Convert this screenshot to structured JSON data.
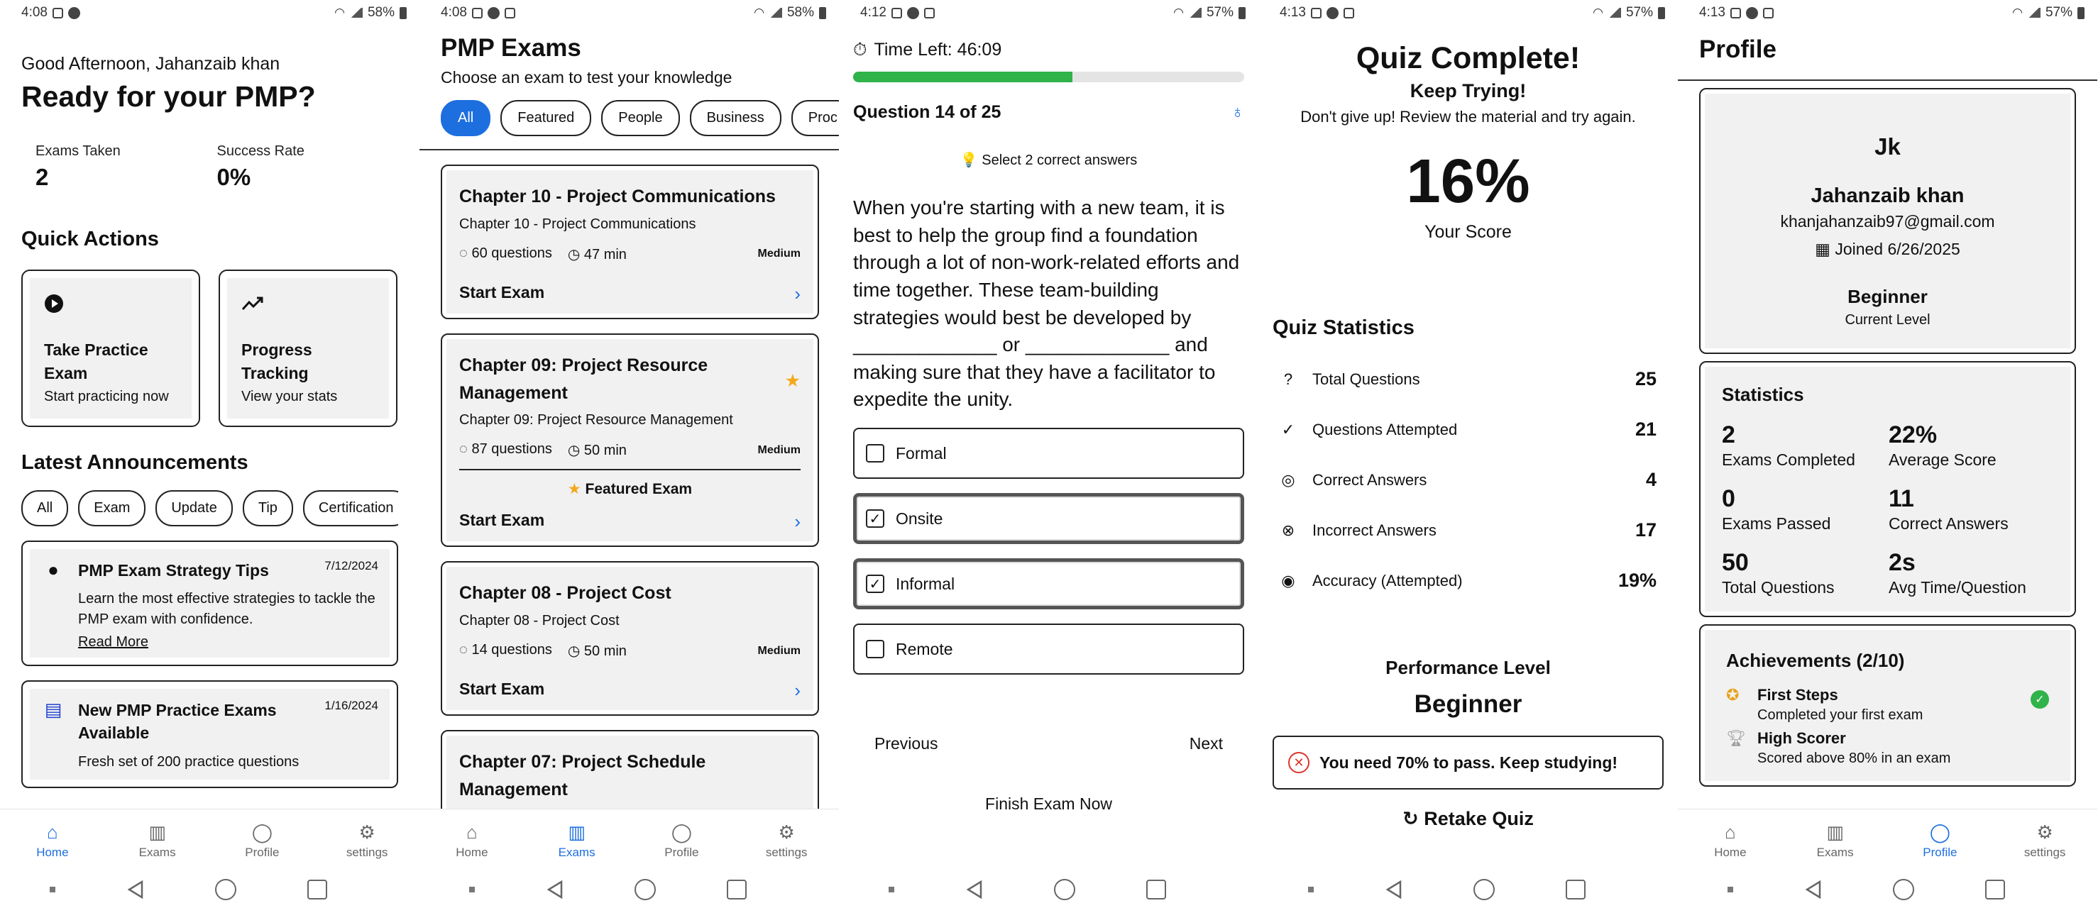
{
  "status_bars": [
    {
      "time": "4:08",
      "battery": "58%"
    },
    {
      "time": "4:08",
      "battery": "58%"
    },
    {
      "time": "4:12",
      "battery": "57%"
    },
    {
      "time": "4:13",
      "battery": "57%"
    },
    {
      "time": "4:13",
      "battery": "57%"
    }
  ],
  "bottom_nav": {
    "home": "Home",
    "exams": "Exams",
    "profile": "Profile",
    "settings": "settings"
  },
  "home": {
    "greeting": "Good Afternoon, Jahanzaib khan",
    "headline": "Ready for your PMP?",
    "stats": [
      {
        "label": "Exams Taken",
        "value": "2"
      },
      {
        "label": "Success Rate",
        "value": "0%"
      }
    ],
    "quick_actions_title": "Quick Actions",
    "quick_actions": [
      {
        "title": "Take Practice Exam",
        "subtitle": "Start practicing now",
        "icon": "play-icon"
      },
      {
        "title": "Progress Tracking",
        "subtitle": "View your stats",
        "icon": "trend-icon"
      }
    ],
    "announcements_title": "Latest Announcements",
    "filters": [
      "All",
      "Exam",
      "Update",
      "Tip",
      "Certification"
    ],
    "announcements": [
      {
        "title": "PMP Exam Strategy Tips",
        "date": "7/12/2024",
        "desc": "Learn the most effective strategies to tackle the PMP exam with confidence.",
        "link": "Read More",
        "icon": "bulb-icon"
      },
      {
        "title": "New PMP Practice Exams Available",
        "date": "1/16/2024",
        "desc": "Fresh set of 200 practice questions",
        "icon": "document-icon"
      }
    ]
  },
  "exams": {
    "title": "PMP Exams",
    "subtitle": "Choose an exam to test your knowledge",
    "filters": [
      "All",
      "Featured",
      "People",
      "Business",
      "Proc"
    ],
    "cards": [
      {
        "title": "Chapter 10 - Project Communications",
        "sub": "Chapter 10 - Project Communications",
        "questions": "60 questions",
        "time": "47 min",
        "difficulty": "Medium",
        "start": "Start Exam",
        "featured": false
      },
      {
        "title": "Chapter 09: Project Resource Management",
        "sub": "Chapter 09: Project Resource Management",
        "questions": "87 questions",
        "time": "50 min",
        "difficulty": "Medium",
        "start": "Start Exam",
        "featured": true,
        "featured_label": "Featured Exam"
      },
      {
        "title": "Chapter 08 - Project Cost",
        "sub": "Chapter 08 - Project Cost",
        "questions": "14 questions",
        "time": "50 min",
        "difficulty": "Medium",
        "start": "Start Exam",
        "featured": false
      },
      {
        "title": "Chapter 07: Project Schedule Management",
        "featured": false
      }
    ]
  },
  "quiz": {
    "timer": "Time Left: 46:09",
    "progress": 0.56,
    "question_number": "Question 14 of 25",
    "hint": "Select 2 correct answers",
    "question": "When you're starting with a new team, it is best to help the group find a foundation through a lot of non-work-related efforts and time together. These team-building strategies would best be developed by _____________ or _____________ and making sure that they have a facilitator to expedite the unity.",
    "options": [
      {
        "label": "Formal",
        "checked": false
      },
      {
        "label": "Onsite",
        "checked": true
      },
      {
        "label": "Informal",
        "checked": true
      },
      {
        "label": "Remote",
        "checked": false
      }
    ],
    "prev": "Previous",
    "next": "Next",
    "finish": "Finish Exam Now"
  },
  "result": {
    "title": "Quiz Complete!",
    "subtitle": "Keep Trying!",
    "message": "Don't give up! Review the material and try again.",
    "score": "16%",
    "score_label": "Your Score",
    "stats_title": "Quiz Statistics",
    "stats": [
      {
        "icon": "?",
        "label": "Total Questions",
        "value": "25"
      },
      {
        "icon": "✓",
        "label": "Questions Attempted",
        "value": "21"
      },
      {
        "icon": "◎",
        "label": "Correct Answers",
        "value": "4"
      },
      {
        "icon": "⊗",
        "label": "Incorrect Answers",
        "value": "17"
      },
      {
        "icon": "◉",
        "label": "Accuracy (Attempted)",
        "value": "19%"
      }
    ],
    "perf_label": "Performance Level",
    "perf_value": "Beginner",
    "pass_msg": "You need 70% to pass. Keep studying!",
    "retake": "Retake Quiz"
  },
  "profile": {
    "title": "Profile",
    "initials": "Jk",
    "name": "Jahanzaib khan",
    "email": "khanjahanzaib97@gmail.com",
    "joined": "Joined 6/26/2025",
    "level": "Beginner",
    "level_label": "Current Level",
    "stats_title": "Statistics",
    "stats": [
      {
        "value": "2",
        "label": "Exams Completed"
      },
      {
        "value": "22%",
        "label": "Average Score"
      },
      {
        "value": "0",
        "label": "Exams Passed"
      },
      {
        "value": "11",
        "label": "Correct Answers"
      },
      {
        "value": "50",
        "label": "Total Questions"
      },
      {
        "value": "2s",
        "label": "Avg Time/Question"
      }
    ],
    "achievements_title": "Achievements (2/10)",
    "achievements": [
      {
        "title": "First Steps",
        "desc": "Completed your first exam",
        "done": true
      },
      {
        "title": "High Scorer",
        "desc": "Scored above 80% in an exam",
        "done": false
      }
    ]
  },
  "colors": {
    "accent": "#1d6fe0",
    "progress": "#2fb34a",
    "error": "#e0342b",
    "star": "#f4a91b"
  }
}
